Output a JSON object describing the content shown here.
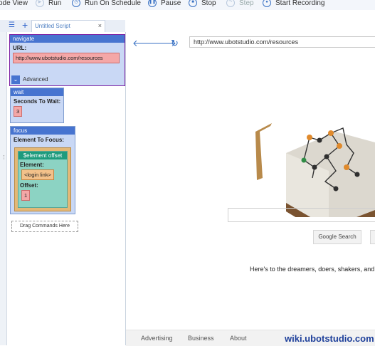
{
  "toolbar": {
    "code_view": "ode View",
    "run": "Run",
    "run_on_schedule": "Run On Schedule",
    "pause": "Pause",
    "stop": "Stop",
    "step": "Step",
    "start_recording": "Start Recording"
  },
  "tab": {
    "title": "Untitled Script",
    "close": "×"
  },
  "commands": {
    "navigate": {
      "title": "navigate",
      "url_label": "URL:",
      "url_value": "http://www.ubotstudio.com/resources",
      "advanced": "Advanced"
    },
    "wait": {
      "title": "wait",
      "label": "Seconds To Wait:",
      "value": "3"
    },
    "focus": {
      "title": "focus",
      "label": "Element To Focus:",
      "offset_title": "$element offset",
      "element_label": "Element:",
      "element_value": "<login link>",
      "offset_label": "Offset:",
      "offset_value": "1"
    },
    "drag_hint": "Drag Commands Here"
  },
  "browser": {
    "url": "http://www.ubotstudio.com/resources",
    "search_button": "Google Search",
    "tagline": "Here's to the dreamers, doers, shakers, and",
    "footer": {
      "advertising": "Advertising",
      "business": "Business",
      "about": "About"
    },
    "watermark": "wiki.ubotstudio.com"
  },
  "colors": {
    "command_header": "#4774d0",
    "url_field": "#f4a7a7",
    "selected_border": "#7b1fa2",
    "offset_header": "#1e9b7d",
    "accent": "#3a72c4"
  }
}
